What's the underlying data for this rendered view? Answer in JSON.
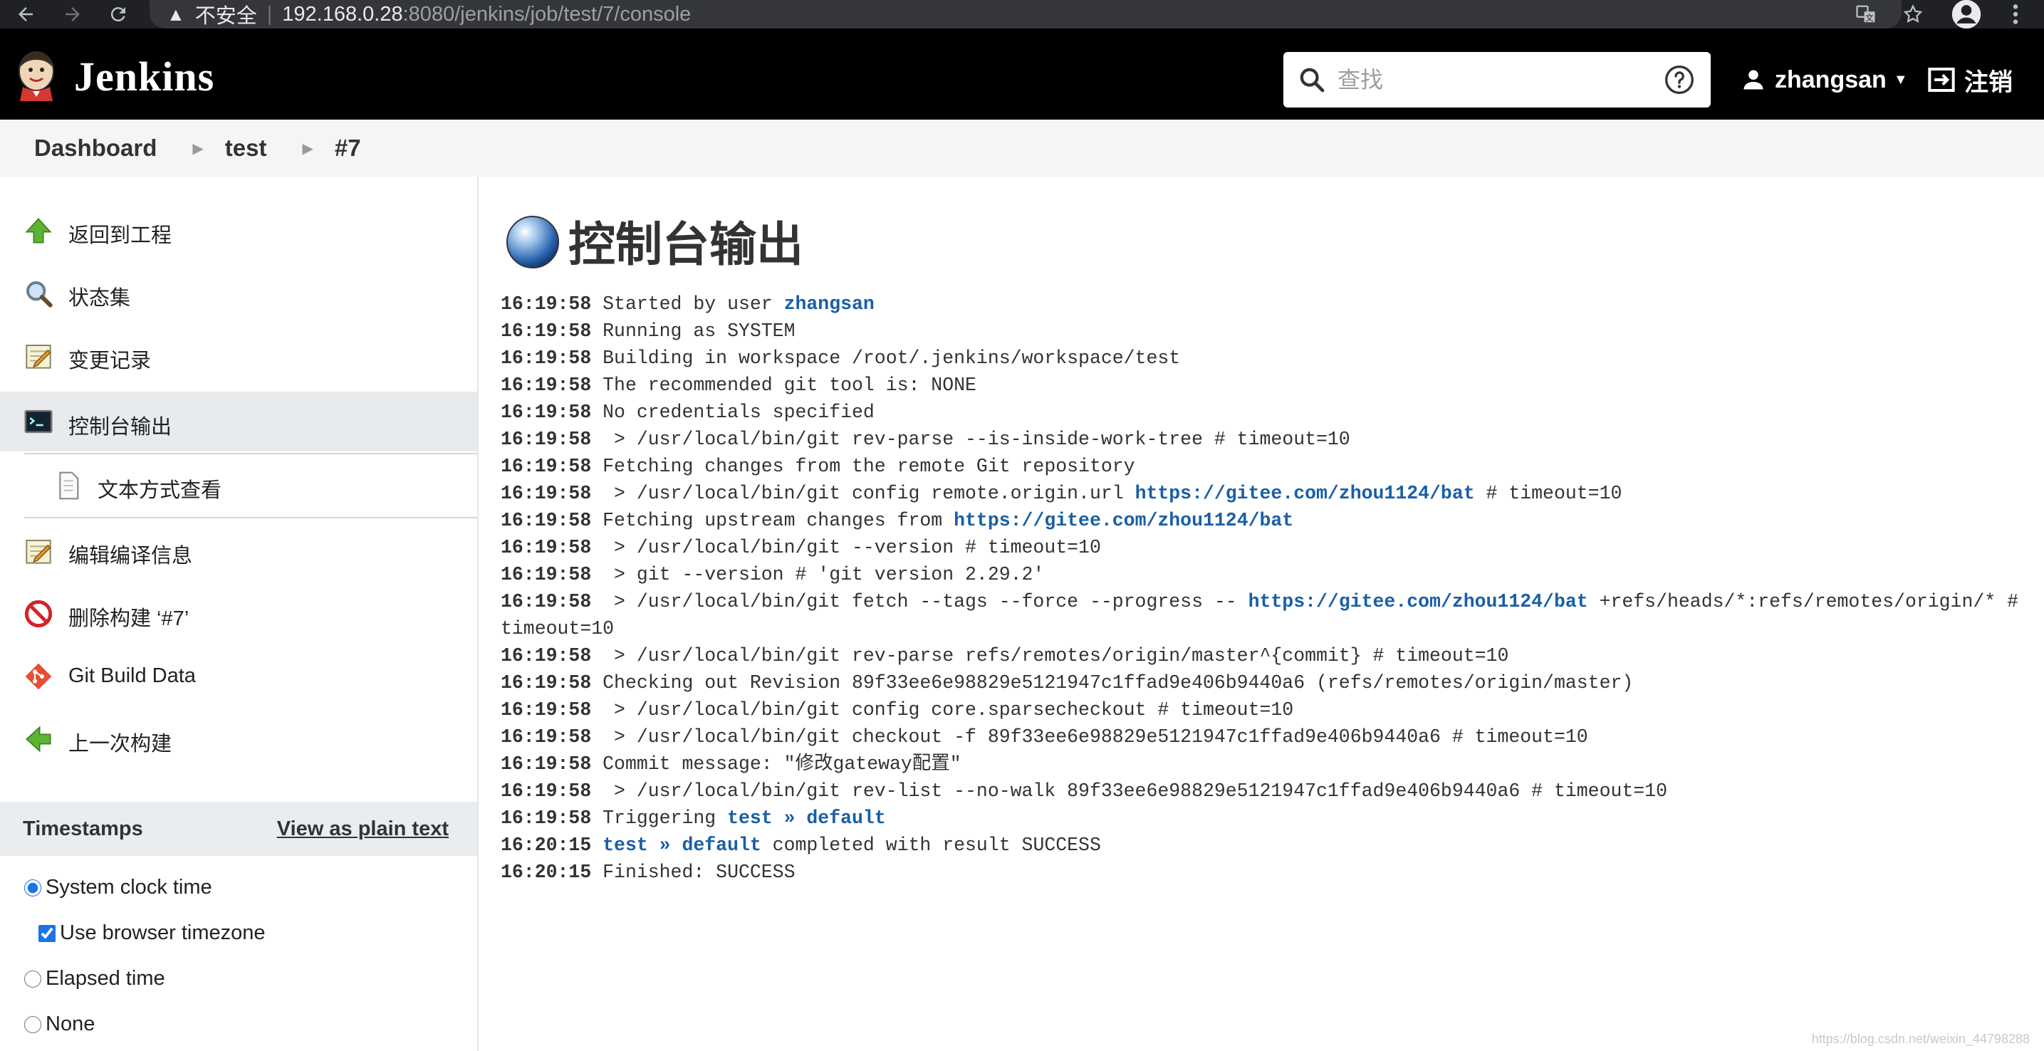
{
  "browser": {
    "security_label": "不安全",
    "url_host": "192.168.0.28",
    "url_path": ":8080/jenkins/job/test/7/console"
  },
  "header": {
    "brand": "Jenkins",
    "search_placeholder": "查找",
    "user": "zhangsan",
    "logout_label": "注销"
  },
  "breadcrumb": [
    "Dashboard",
    "test",
    "#7"
  ],
  "sidebar": {
    "tasks": [
      {
        "label": "返回到工程",
        "icon": "up-arrow-icon"
      },
      {
        "label": "状态集",
        "icon": "magnifier-icon"
      },
      {
        "label": "变更记录",
        "icon": "notepad-icon"
      },
      {
        "label": "控制台输出",
        "icon": "terminal-icon",
        "active": true
      },
      {
        "label": "文本方式查看",
        "icon": "document-icon",
        "sub": true
      },
      {
        "label": "编辑编译信息",
        "icon": "notepad-icon"
      },
      {
        "label": "删除构建 ‘#7’",
        "icon": "no-entry-icon"
      },
      {
        "label": "Git Build Data",
        "icon": "git-icon"
      },
      {
        "label": "上一次构建",
        "icon": "left-arrow-icon"
      }
    ],
    "timestamps": {
      "title": "Timestamps",
      "plain_text_link": "View as plain text",
      "options": [
        {
          "label": "System clock time",
          "type": "radio",
          "checked": true
        },
        {
          "label": "Use browser timezone",
          "type": "checkbox",
          "checked": true
        },
        {
          "label": "Elapsed time",
          "type": "radio",
          "checked": false
        },
        {
          "label": "None",
          "type": "radio",
          "checked": false
        }
      ]
    }
  },
  "main": {
    "title": "控制台输出",
    "console_lines": [
      [
        {
          "t": "16:19:58",
          "s": "ts"
        },
        {
          "t": " Started by user "
        },
        {
          "t": "zhangsan",
          "s": "link"
        }
      ],
      [
        {
          "t": "16:19:58",
          "s": "ts"
        },
        {
          "t": " Running as SYSTEM"
        }
      ],
      [
        {
          "t": "16:19:58",
          "s": "ts"
        },
        {
          "t": " Building in workspace /root/.jenkins/workspace/test"
        }
      ],
      [
        {
          "t": "16:19:58",
          "s": "ts"
        },
        {
          "t": " The recommended git tool is: NONE"
        }
      ],
      [
        {
          "t": "16:19:58",
          "s": "ts"
        },
        {
          "t": " No credentials specified"
        }
      ],
      [
        {
          "t": "16:19:58",
          "s": "ts"
        },
        {
          "t": "  > /usr/local/bin/git rev-parse --is-inside-work-tree # timeout=10"
        }
      ],
      [
        {
          "t": "16:19:58",
          "s": "ts"
        },
        {
          "t": " Fetching changes from the remote Git repository"
        }
      ],
      [
        {
          "t": "16:19:58",
          "s": "ts"
        },
        {
          "t": "  > /usr/local/bin/git config remote.origin.url "
        },
        {
          "t": "https://gitee.com/zhou1124/bat",
          "s": "link"
        },
        {
          "t": " # timeout=10"
        }
      ],
      [
        {
          "t": "16:19:58",
          "s": "ts"
        },
        {
          "t": " Fetching upstream changes from "
        },
        {
          "t": "https://gitee.com/zhou1124/bat",
          "s": "link"
        }
      ],
      [
        {
          "t": "16:19:58",
          "s": "ts"
        },
        {
          "t": "  > /usr/local/bin/git --version # timeout=10"
        }
      ],
      [
        {
          "t": "16:19:58",
          "s": "ts"
        },
        {
          "t": "  > git --version # 'git version 2.29.2'"
        }
      ],
      [
        {
          "t": "16:19:58",
          "s": "ts"
        },
        {
          "t": "  > /usr/local/bin/git fetch --tags --force --progress -- "
        },
        {
          "t": "https://gitee.com/zhou1124/bat",
          "s": "link"
        },
        {
          "t": " +refs/heads/*:refs/remotes/origin/* # timeout=10"
        }
      ],
      [
        {
          "t": "16:19:58",
          "s": "ts"
        },
        {
          "t": "  > /usr/local/bin/git rev-parse refs/remotes/origin/master^{commit} # timeout=10"
        }
      ],
      [
        {
          "t": "16:19:58",
          "s": "ts"
        },
        {
          "t": " Checking out Revision 89f33ee6e98829e5121947c1ffad9e406b9440a6 (refs/remotes/origin/master)"
        }
      ],
      [
        {
          "t": "16:19:58",
          "s": "ts"
        },
        {
          "t": "  > /usr/local/bin/git config core.sparsecheckout # timeout=10"
        }
      ],
      [
        {
          "t": "16:19:58",
          "s": "ts"
        },
        {
          "t": "  > /usr/local/bin/git checkout -f 89f33ee6e98829e5121947c1ffad9e406b9440a6 # timeout=10"
        }
      ],
      [
        {
          "t": "16:19:58",
          "s": "ts"
        },
        {
          "t": " Commit message: \"修改gateway配置\""
        }
      ],
      [
        {
          "t": "16:19:58",
          "s": "ts"
        },
        {
          "t": "  > /usr/local/bin/git rev-list --no-walk 89f33ee6e98829e5121947c1ffad9e406b9440a6 # timeout=10"
        }
      ],
      [
        {
          "t": "16:19:58",
          "s": "ts"
        },
        {
          "t": " Triggering "
        },
        {
          "t": "test » default",
          "s": "link"
        }
      ],
      [
        {
          "t": "16:20:15",
          "s": "ts"
        },
        {
          "t": " "
        },
        {
          "t": "test » default",
          "s": "link"
        },
        {
          "t": " completed with result SUCCESS"
        }
      ],
      [
        {
          "t": "16:20:15",
          "s": "ts"
        },
        {
          "t": " Finished: SUCCESS"
        }
      ]
    ]
  },
  "watermark": "https://blog.csdn.net/weixin_44798288"
}
